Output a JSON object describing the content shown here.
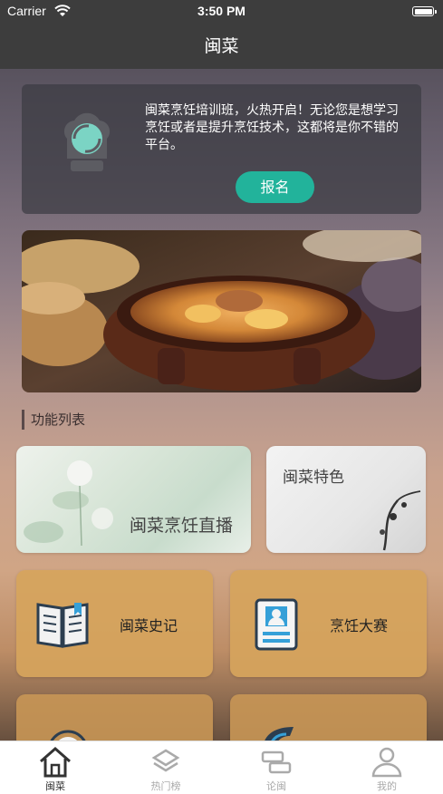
{
  "status_bar": {
    "carrier": "Carrier",
    "time": "3:50 PM"
  },
  "nav": {
    "title": "闽菜"
  },
  "promo": {
    "text": "闽菜烹饪培训班，火热开启！无论您是想学习烹饪或者是提升烹饪技术，这都将是你不错的平台。",
    "button_label": "报名",
    "icon": "chef-hat-icon"
  },
  "section": {
    "title": "功能列表"
  },
  "features": {
    "live": {
      "label": "闽菜烹饪直播"
    },
    "specialty": {
      "label": "闽菜特色"
    },
    "history": {
      "label": "闽菜史记",
      "icon": "book-icon"
    },
    "contest": {
      "label": "烹饪大赛",
      "icon": "id-card-icon"
    }
  },
  "tabs": [
    {
      "label": "闽菜",
      "icon": "home-icon",
      "active": true
    },
    {
      "label": "热门榜",
      "icon": "layers-icon",
      "active": false
    },
    {
      "label": "论闽",
      "icon": "forum-icon",
      "active": false
    },
    {
      "label": "我的",
      "icon": "user-icon",
      "active": false
    }
  ],
  "colors": {
    "accent": "#22b39b",
    "bar": "#3d3d3d"
  }
}
